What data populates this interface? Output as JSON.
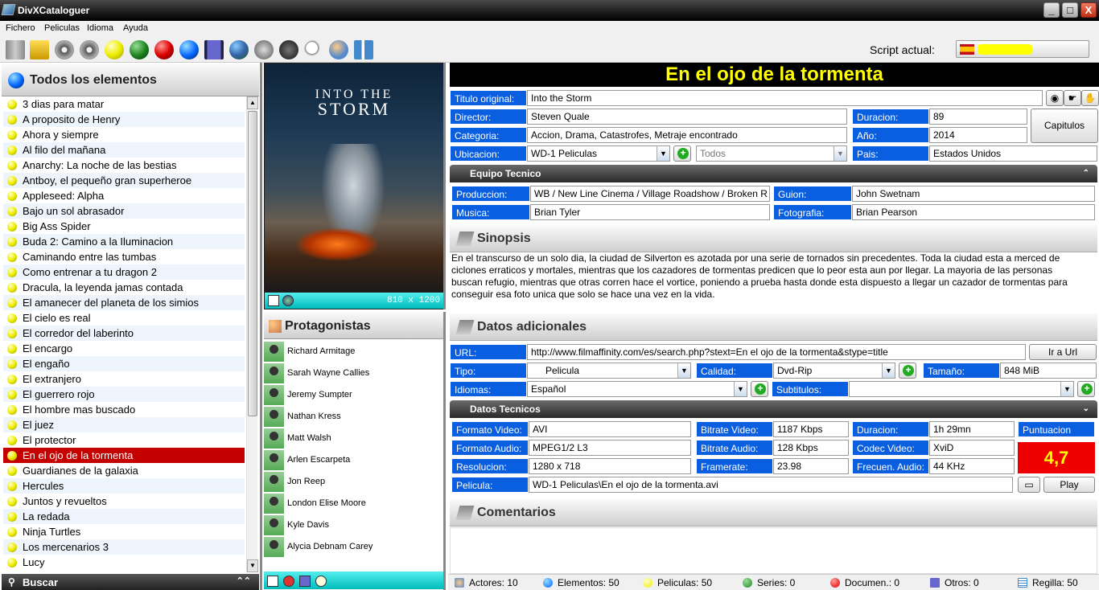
{
  "window": {
    "title": "DivXCataloguer",
    "minimize": "_",
    "maximize": "□",
    "close": "X"
  },
  "menu": {
    "items": [
      "Fichero",
      "Peliculas",
      "Idioma",
      "Ayuda"
    ]
  },
  "toolbar": {
    "script_label": "Script actual:"
  },
  "list": {
    "header": "Todos los elementos",
    "selected": "En el ojo de la tormenta",
    "items": [
      "3 dias para matar",
      "A proposito de Henry",
      "Ahora y siempre",
      "Al filo del mañana",
      "Anarchy: La noche de las bestias",
      "Antboy, el pequeño gran superheroe",
      "Appleseed: Alpha",
      "Bajo un sol abrasador",
      "Big Ass Spider",
      "Buda 2: Camino a la Iluminacion",
      "Caminando entre las tumbas",
      "Como entrenar a tu dragon 2",
      "Dracula, la leyenda jamas contada",
      "El amanecer del planeta de los simios",
      "El cielo es real",
      "El corredor del laberinto",
      "El encargo",
      "El engaño",
      "El extranjero",
      "El guerrero rojo",
      "El hombre mas buscado",
      "El juez",
      "El protector",
      "En el ojo de la tormenta",
      "Guardianes de la galaxia",
      "Hercules",
      "Juntos y revueltos",
      "La redada",
      "Ninja Turtles",
      "Los mercenarios 3",
      "Lucy"
    ],
    "search_label": "Buscar"
  },
  "poster": {
    "line1": "INTO THE",
    "line2": "STORM",
    "size_text": "810 x 1200"
  },
  "protagonists": {
    "header": "Protagonistas",
    "actors": [
      "Richard Armitage",
      "Sarah Wayne Callies",
      "Jeremy Sumpter",
      "Nathan Kress",
      "Matt Walsh",
      "Arlen Escarpeta",
      "Jon Reep",
      "London Elise Moore",
      "Kyle Davis",
      "Alycia Debnam Carey"
    ]
  },
  "movie": {
    "title": "En el ojo de la tormenta",
    "labels": {
      "original_title": "Titulo original:",
      "director": "Director:",
      "category": "Categoria:",
      "location": "Ubicacion:",
      "duration": "Duracion:",
      "year": "Año:",
      "country": "Pais:",
      "chapters": "Capitulos"
    },
    "original_title": "Into the Storm",
    "director": "Steven Quale",
    "category": "Accion, Drama, Catastrofes, Metraje encontrado",
    "location": "WD-1 Peliculas",
    "filter": "Todos",
    "duration": "89",
    "year": "2014",
    "country": "Estados Unidos"
  },
  "crew": {
    "header": "Equipo Tecnico",
    "labels": {
      "production": "Produccion:",
      "music": "Musica:",
      "script": "Guion:",
      "photo": "Fotografia:"
    },
    "production": "WB / New Line Cinema / Village Roadshow / Broken R",
    "music": "Brian Tyler",
    "script": "John Swetnam",
    "photo": "Brian Pearson"
  },
  "synopsis": {
    "header": "Sinopsis",
    "text": "En el transcurso de un solo dia, la ciudad de Silverton es azotada por una serie de tornados sin precedentes. Toda la ciudad esta a merced de ciclones erraticos y mortales, mientras que los cazadores de tormentas predicen que lo peor esta aun por llegar. La mayoria de las personas buscan refugio, mientras que otras corren hace el vortice, poniendo a prueba hasta donde esta dispuesto a llegar un cazador de tormentas para conseguir esa foto unica que solo se hace una vez en la vida."
  },
  "additional": {
    "header": "Datos adicionales",
    "labels": {
      "url": "URL:",
      "type": "Tipo:",
      "quality": "Calidad:",
      "size": "Tamaño:",
      "languages": "Idiomas:",
      "subtitles": "Subtitulos:"
    },
    "url": "http://www.filmaffinity.com/es/search.php?stext=En el ojo de la tormenta&stype=title",
    "go_url": "Ir a Url",
    "type": "Pelicula",
    "quality": "Dvd-Rip",
    "size": "848 MiB",
    "languages": "Español",
    "subtitles": ""
  },
  "tech": {
    "header": "Datos Tecnicos",
    "labels": {
      "video_format": "Formato Video:",
      "audio_format": "Formato Audio:",
      "resolution": "Resolucion:",
      "video_bitrate": "Bitrate Video:",
      "audio_bitrate": "Bitrate Audio:",
      "framerate": "Framerate:",
      "duration": "Duracion:",
      "video_codec": "Codec Video:",
      "audio_freq": "Frecuen. Audio:",
      "rating": "Puntuacion",
      "file": "Pelicula:"
    },
    "video_format": "AVI",
    "audio_format": "MPEG1/2 L3",
    "resolution": "1280 x 718",
    "video_bitrate": "1187 Kbps",
    "audio_bitrate": "128 Kbps",
    "framerate": "23.98",
    "duration": "1h 29mn",
    "video_codec": "XviD",
    "audio_freq": "44 KHz",
    "rating": "4,7",
    "file": "WD-1 Peliculas\\En el ojo de la tormenta.avi",
    "play": "Play"
  },
  "comments": {
    "header": "Comentarios"
  },
  "status": {
    "actors": "Actores: 10",
    "elements": "Elementos: 50",
    "movies": "Peliculas: 50",
    "series": "Series: 0",
    "docs": "Documen.: 0",
    "others": "Otros: 0",
    "grid": "Regilla: 50"
  }
}
